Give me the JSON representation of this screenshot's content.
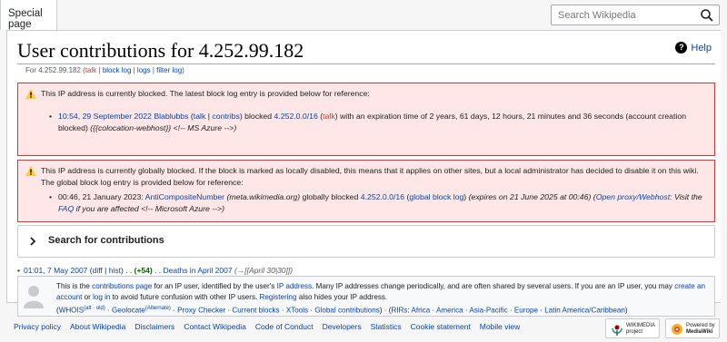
{
  "header": {
    "special_tab": "Special page",
    "search_placeholder": "Search Wikipedia"
  },
  "title": "User contributions for 4.252.99.182",
  "help_label": "Help",
  "subtitle": {
    "prefix": "For 4.252.99.182 (",
    "talk": "talk",
    "block_log": "block log",
    "logs": "logs",
    "filter_log": "filter log",
    "suffix": ")"
  },
  "block1": {
    "message": "This IP address is currently blocked. The latest block log entry is provided below for reference:",
    "entry_date": "10:54, 29 September 2022",
    "entry_user": "Blablubbs",
    "entry_talk": "talk",
    "entry_contribs": "contribs",
    "entry_blocked": "blocked",
    "entry_range": "4.252.0.0/16",
    "entry_talk2": "talk",
    "entry_rest": "with an expiration time of 2 years, 61 days, 12 hours, 21 minutes and 36 seconds (account creation blocked)",
    "entry_reason": "({{colocation-webhost}} <!-- MS Azure -->)"
  },
  "block2": {
    "message": "This IP address is currently globally blocked. If the block is marked as locally disabled, this means that it applies on other sites, but a local administrator has decided to disable it on this wiki. The global block log entry is provided below for reference:",
    "entry_date": "00:46, 21 January 2023:",
    "entry_user": "AntiCompositeNumber",
    "entry_site": "(meta.wikimedia.org)",
    "entry_blocked": "globally blocked",
    "entry_range": "4.252.0.0/16",
    "entry_log": "global block log",
    "entry_expires": "(expires on 21 June 2025 at 00:46)",
    "entry_reason_link": "Open proxy/Webhost",
    "entry_reason_mid": ": Visit the",
    "entry_faq": "FAQ",
    "entry_reason_end": "if you are affected <!-- Microsoft Azure -->)"
  },
  "search_section": {
    "heading": "Search for contributions"
  },
  "contributions": [
    {
      "date": "01:01, 7 May 2007",
      "diff": "diff",
      "hist": "hist",
      "size": "(+54)",
      "page": "Deaths in April 2007",
      "summary": "(→[[April 30|30]])"
    }
  ],
  "info": {
    "t1": "This is the ",
    "l1": "contributions page",
    "t2": " for an IP user, identified by the user's ",
    "l2": "IP address",
    "t3": ". Many IP addresses change periodically, and are often shared by several users. If you are an IP user, you may ",
    "l3": "create an account",
    "t4": " or ",
    "l4": "log in",
    "t5": " to avoid future confusion with other IP users. ",
    "l5": "Registering",
    "t6": " also hides your IP address.",
    "whois": "WHOIS",
    "alt_old": "(alt · old)",
    "geolocate": "Geolocate",
    "alternate": "(Alternate)",
    "proxy": "Proxy Checker",
    "blocks": "Current blocks",
    "xtools": "XTools",
    "global": "Global contributions",
    "rirs_label": "RIRs",
    "africa": "Africa",
    "america": "America",
    "asia": "Asia-Pacific",
    "europe": "Europe",
    "latam": "Latin America/Caribbean"
  },
  "footer": {
    "links": [
      "Privacy policy",
      "About Wikipedia",
      "Disclaimers",
      "Contact Wikipedia",
      "Code of Conduct",
      "Developers",
      "Statistics",
      "Cookie statement",
      "Mobile view"
    ],
    "wm_badge": [
      "WIKIMEDIA",
      "project"
    ],
    "mw_badge": [
      "Powered by",
      "MediaWiki"
    ]
  },
  "colors": {
    "link": "#0645ad",
    "error_bg": "#fee7e6",
    "error_border": "#d33",
    "red_link": "#d33"
  }
}
